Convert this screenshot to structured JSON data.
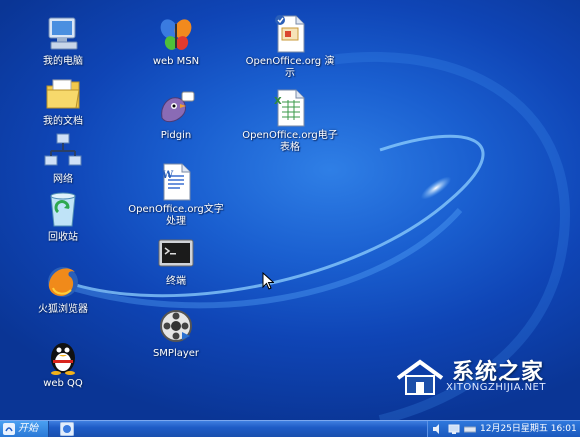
{
  "desktop": {
    "icons": [
      {
        "id": "my-computer",
        "label": "我的电脑",
        "icon": "computer-icon"
      },
      {
        "id": "my-documents",
        "label": "我的文档",
        "icon": "folder-icon"
      },
      {
        "id": "network",
        "label": "网络",
        "icon": "network-icon"
      },
      {
        "id": "recycle-bin",
        "label": "回收站",
        "icon": "recycle-bin-icon"
      },
      {
        "id": "firefox",
        "label": "火狐浏览器",
        "icon": "firefox-icon"
      },
      {
        "id": "web-qq",
        "label": "web QQ",
        "icon": "qq-penguin-icon"
      },
      {
        "id": "web-msn",
        "label": "web MSN",
        "icon": "msn-butterfly-icon"
      },
      {
        "id": "pidgin",
        "label": "Pidgin",
        "icon": "pidgin-icon"
      },
      {
        "id": "oo-writer",
        "label": "OpenOffice.org文字处理",
        "icon": "writer-document-icon"
      },
      {
        "id": "terminal",
        "label": "终端",
        "icon": "terminal-icon"
      },
      {
        "id": "smplayer",
        "label": "SMPlayer",
        "icon": "smplayer-icon"
      },
      {
        "id": "oo-impress",
        "label": "OpenOffice.org 演示",
        "icon": "impress-presentation-icon"
      },
      {
        "id": "oo-calc",
        "label": "OpenOffice.org电子表格",
        "icon": "calc-spreadsheet-icon"
      }
    ]
  },
  "watermark": {
    "title": "系统之家",
    "url": "XITONGZHIJIA.NET"
  },
  "taskbar": {
    "start_label": "开始",
    "clock": "12月25日星期五 16:01"
  },
  "colors": {
    "desktop": "#1a5fd0",
    "taskbar": "#1e5cc6",
    "label_text": "#ffffff"
  }
}
